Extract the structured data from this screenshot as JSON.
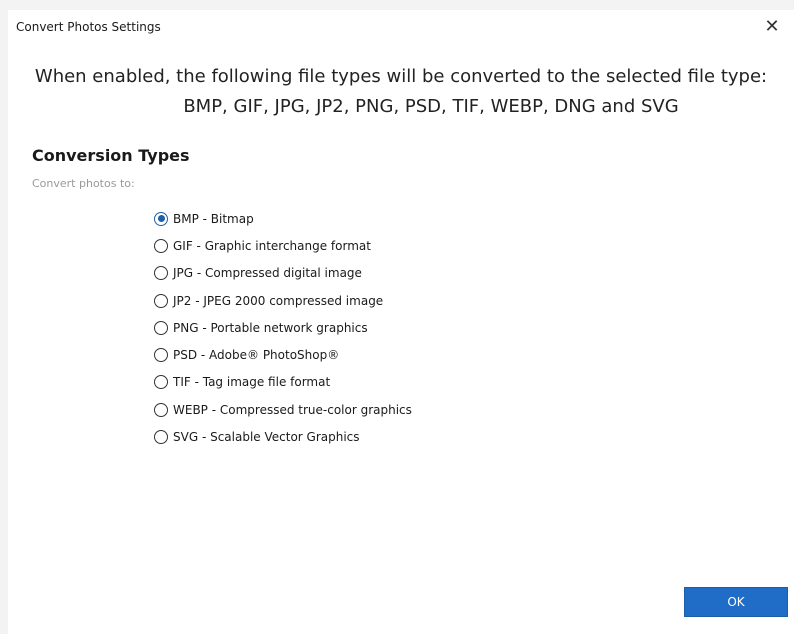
{
  "window": {
    "title": "Convert Photos Settings",
    "close_glyph": "✕"
  },
  "headline": {
    "line1": "When enabled, the following file types will be converted to the selected file type:",
    "line2": "BMP, GIF, JPG, JP2, PNG, PSD, TIF, WEBP, DNG and SVG"
  },
  "section": {
    "title": "Conversion Types",
    "subtitle": "Convert photos to:"
  },
  "options": [
    {
      "label": "BMP - Bitmap",
      "selected": true
    },
    {
      "label": "GIF - Graphic interchange format",
      "selected": false
    },
    {
      "label": "JPG - Compressed digital image",
      "selected": false
    },
    {
      "label": "JP2 - JPEG 2000 compressed image",
      "selected": false
    },
    {
      "label": "PNG - Portable network graphics",
      "selected": false
    },
    {
      "label": "PSD - Adobe® PhotoShop®",
      "selected": false
    },
    {
      "label": "TIF - Tag image file format",
      "selected": false
    },
    {
      "label": "WEBP - Compressed true-color graphics",
      "selected": false
    },
    {
      "label": "SVG - Scalable Vector Graphics",
      "selected": false
    }
  ],
  "footer": {
    "ok_label": "OK"
  },
  "colors": {
    "accent": "#1f6dc6",
    "radio_selected": "#1f5fa8"
  }
}
